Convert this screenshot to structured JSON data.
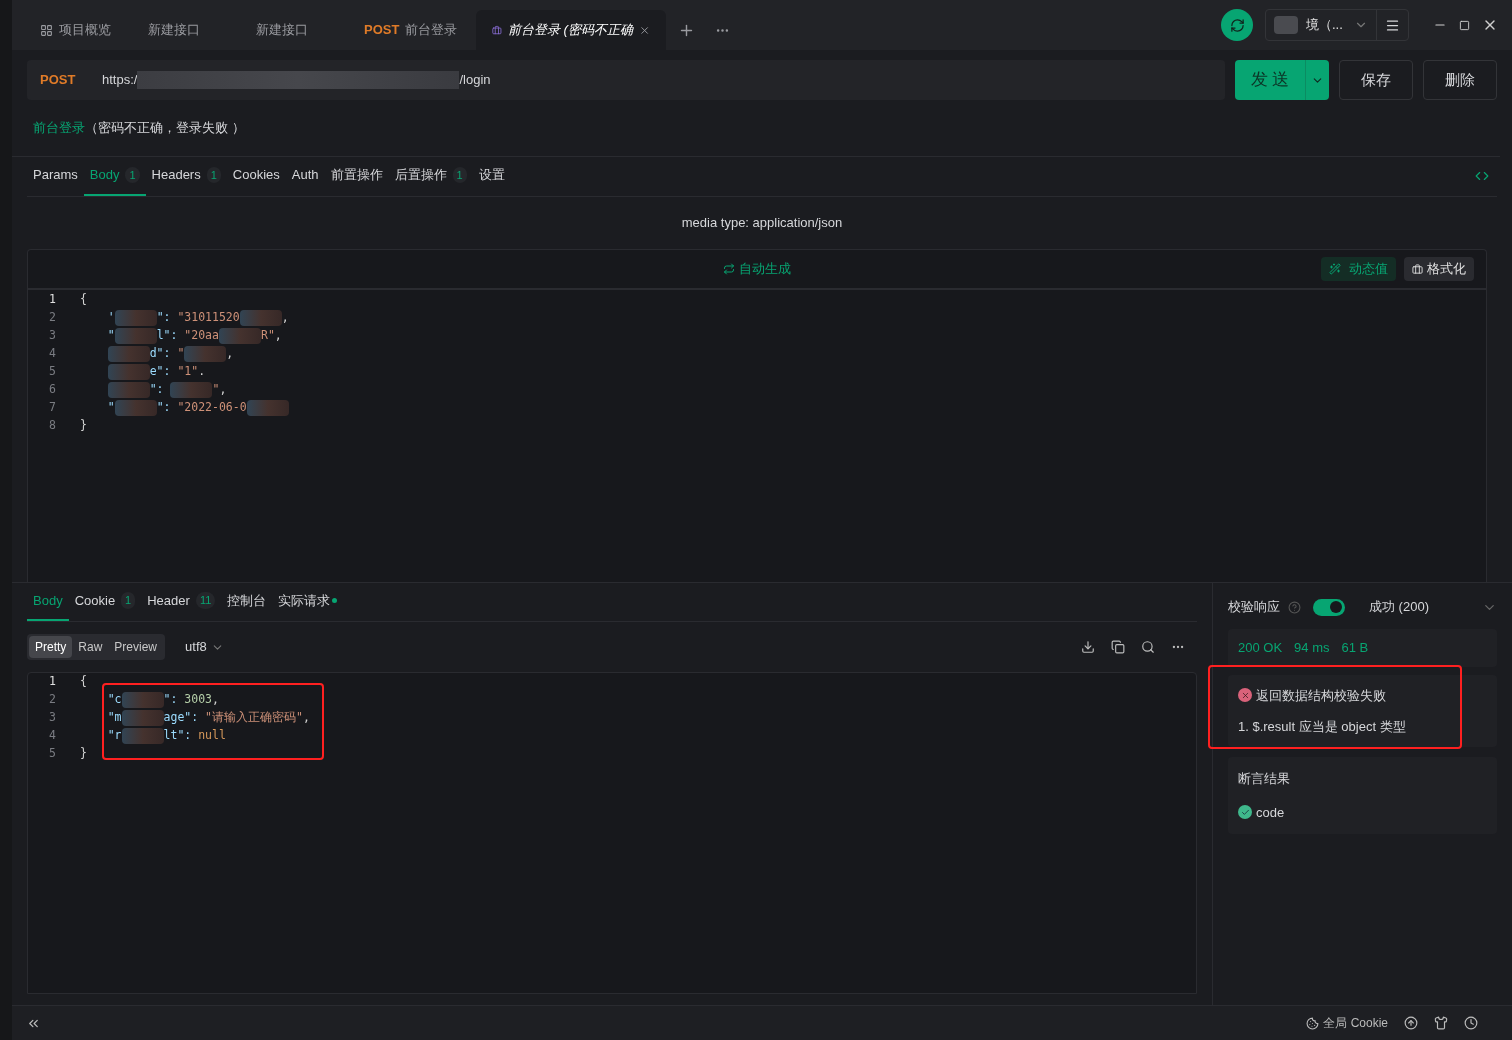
{
  "tabs": [
    {
      "kind": "overview",
      "label": "项目概览",
      "selected": false
    },
    {
      "kind": "plain",
      "label": "新建接口",
      "selected": false
    },
    {
      "kind": "plain",
      "label": "新建接口",
      "selected": false
    },
    {
      "kind": "method",
      "method": "POST",
      "label": "前台登录",
      "selected": false
    },
    {
      "kind": "case",
      "label": "前台登录 (密码不正确",
      "selected": true
    }
  ],
  "topbar": {
    "environment": "境（...",
    "sync_on": true
  },
  "request": {
    "method": "POST",
    "url_start": "https:/",
    "url_end": "/login",
    "send": "发 送",
    "save": "保存",
    "delete": "删除"
  },
  "breadcrumb": {
    "api": "前台登录",
    "case": "（密码不正确，登录失败 ）"
  },
  "request_tabs": [
    {
      "label": "Params",
      "selected": false
    },
    {
      "label": "Body",
      "count": "1",
      "selected": true
    },
    {
      "label": "Headers",
      "count": "1",
      "selected": false
    },
    {
      "label": "Cookies",
      "selected": false
    },
    {
      "label": "Auth",
      "selected": false
    },
    {
      "label": "前置操作",
      "selected": false
    },
    {
      "label": "后置操作",
      "count": "1",
      "selected": false
    },
    {
      "label": "设置",
      "selected": false
    }
  ],
  "media_type": "media type: application/json",
  "editor": {
    "auto_generate": "自动生成",
    "dynamic_value": "动态值",
    "format": "格式化",
    "lines": [
      {
        "number": "1",
        "indented": false,
        "segments": [
          {
            "kind": "punct",
            "text": "{"
          }
        ]
      },
      {
        "number": "2",
        "indented": true,
        "segments": [
          {
            "kind": "key",
            "text": "'"
          },
          {
            "kind": "redacted"
          },
          {
            "kind": "key",
            "text": "\": "
          },
          {
            "kind": "string",
            "text": "\"31011520"
          },
          {
            "kind": "redacted"
          },
          {
            "kind": "punct",
            "text": ","
          }
        ]
      },
      {
        "number": "3",
        "indented": true,
        "segments": [
          {
            "kind": "key",
            "text": "\""
          },
          {
            "kind": "redacted"
          },
          {
            "kind": "key",
            "text": "l\": "
          },
          {
            "kind": "string",
            "text": "\"20aa"
          },
          {
            "kind": "redacted"
          },
          {
            "kind": "string",
            "text": "R\""
          },
          {
            "kind": "punct",
            "text": ","
          }
        ]
      },
      {
        "number": "4",
        "indented": true,
        "segments": [
          {
            "kind": "redacted"
          },
          {
            "kind": "key",
            "text": "d\": "
          },
          {
            "kind": "string",
            "text": "\""
          },
          {
            "kind": "redacted"
          },
          {
            "kind": "punct",
            "text": ","
          }
        ]
      },
      {
        "number": "5",
        "indented": true,
        "segments": [
          {
            "kind": "redacted"
          },
          {
            "kind": "key",
            "text": "e\": "
          },
          {
            "kind": "string",
            "text": "\"1\""
          },
          {
            "kind": "punct",
            "text": "."
          }
        ]
      },
      {
        "number": "6",
        "indented": true,
        "segments": [
          {
            "kind": "redacted"
          },
          {
            "kind": "key",
            "text": "\": "
          },
          {
            "kind": "redacted"
          },
          {
            "kind": "string",
            "text": "\""
          },
          {
            "kind": "punct",
            "text": ","
          }
        ]
      },
      {
        "number": "7",
        "indented": true,
        "segments": [
          {
            "kind": "key",
            "text": "\""
          },
          {
            "kind": "redacted"
          },
          {
            "kind": "key",
            "text": "\": "
          },
          {
            "kind": "string",
            "text": "\"2022-06-0"
          },
          {
            "kind": "redacted"
          }
        ]
      },
      {
        "number": "8",
        "indented": false,
        "segments": [
          {
            "kind": "punct",
            "text": "}"
          }
        ]
      }
    ]
  },
  "response_tabs": [
    {
      "label": "Body",
      "dot": false,
      "selected": true
    },
    {
      "label": "Cookie",
      "count": "1",
      "dot": false,
      "selected": false
    },
    {
      "label": "Header",
      "count": "11",
      "dot": false,
      "selected": false
    },
    {
      "label": "控制台",
      "dot": false,
      "selected": false
    },
    {
      "label": "实际请求",
      "dot": true,
      "selected": false
    }
  ],
  "view_modes": [
    {
      "label": "Pretty",
      "selected": true
    },
    {
      "label": "Raw",
      "selected": false
    },
    {
      "label": "Preview",
      "selected": false
    }
  ],
  "encoding": "utf8",
  "response": {
    "lines": [
      {
        "number": "1",
        "indented": false,
        "segments": [
          {
            "kind": "punct",
            "text": "{"
          }
        ]
      },
      {
        "number": "2",
        "indented": true,
        "segments": [
          {
            "kind": "key",
            "text": "\"c"
          },
          {
            "kind": "redacted"
          },
          {
            "kind": "key",
            "text": "\": "
          },
          {
            "kind": "number",
            "text": "3003"
          },
          {
            "kind": "punct",
            "text": ","
          }
        ]
      },
      {
        "number": "3",
        "indented": true,
        "segments": [
          {
            "kind": "key",
            "text": "\"m"
          },
          {
            "kind": "redacted"
          },
          {
            "kind": "key",
            "text": "age\": "
          },
          {
            "kind": "string",
            "text": "\"请输入正确密码\""
          },
          {
            "kind": "punct",
            "text": ","
          }
        ]
      },
      {
        "number": "4",
        "indented": true,
        "segments": [
          {
            "kind": "key",
            "text": "\"r"
          },
          {
            "kind": "redacted"
          },
          {
            "kind": "key",
            "text": "lt\": "
          },
          {
            "kind": "null",
            "text": "null"
          }
        ]
      },
      {
        "number": "5",
        "indented": false,
        "segments": [
          {
            "kind": "punct",
            "text": "}"
          }
        ]
      }
    ]
  },
  "validation": {
    "label": "校验响应",
    "on": true,
    "result": "成功 (200)",
    "status": "200 OK",
    "time": "94 ms",
    "size": "61 B",
    "error_title": "返回数据结构校验失败",
    "error_detail": "1. $.result 应当是 object 类型"
  },
  "assertions": {
    "title": "断言结果",
    "items": [
      {
        "label": "code",
        "passed": true
      }
    ]
  },
  "status_bar": {
    "cookie": "全局 Cookie"
  }
}
